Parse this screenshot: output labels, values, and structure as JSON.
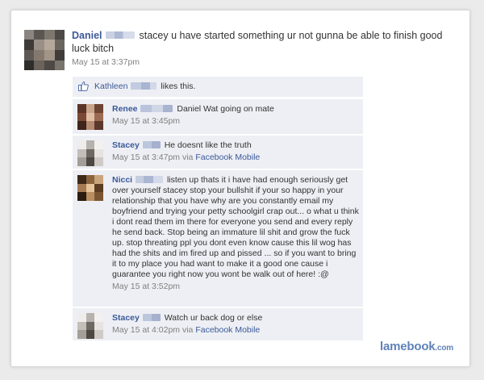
{
  "post": {
    "author": "Daniel",
    "text": "stacey u have started something ur not gunna be able to finish good luck bitch",
    "timestamp": "May 15 at 3:37pm"
  },
  "likes": {
    "name": "Kathleen",
    "text": "likes this.",
    "icon": "thumbs-up-icon"
  },
  "comments": [
    {
      "author": "Renee",
      "text": "Daniel Wat going on mate",
      "timestamp": "May 15 at 3:45pm",
      "via": ""
    },
    {
      "author": "Stacey",
      "text": "He doesnt like the truth",
      "timestamp": "May 15 at 3:47pm via",
      "via": "Facebook Mobile"
    },
    {
      "author": "Nicci",
      "text": "listen up thats it i have had enough seriously get over yourself stacey stop your bullshit if your so happy in your relationship that you have why are you constantly email my boyfriend and trying your petty schoolgirl crap out... o what u think i dont read them im there for everyone you send and every reply he send back. Stop being an immature lil shit and grow the fuck up. stop threating ppl you dont even know cause this lil wog has had the shits and im fired up and pissed ... so if you want to bring it to my place you had want to make it a good one cause i guarantee you right now you wont be walk out of here! :@",
      "timestamp": "May 15 at 3:52pm",
      "via": ""
    },
    {
      "author": "Stacey",
      "text": "Watch ur back dog or else",
      "timestamp": "May 15 at 4:02pm via",
      "via": "Facebook Mobile"
    }
  ],
  "watermark": {
    "brand": "lamebook",
    "suffix": ".com"
  },
  "colors": {
    "link": "#3b5998",
    "comment_bg": "#edeff4",
    "meta_gray": "#808080",
    "watermark": "#5e82b8"
  }
}
